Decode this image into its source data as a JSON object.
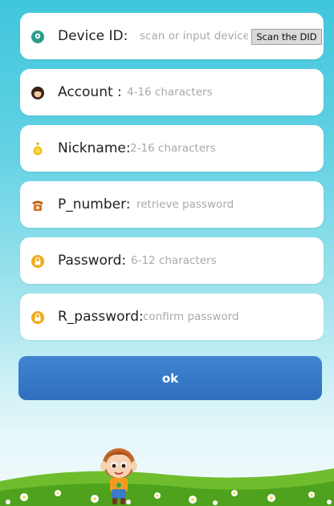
{
  "form": {
    "device_id": {
      "label": "Device ID:",
      "placeholder": "scan or input device ID",
      "value": "",
      "icon": "location-pin-icon"
    },
    "scan_button": {
      "label": "Scan the DID"
    },
    "account": {
      "label": "Account :",
      "placeholder": "4-16 characters",
      "value": "",
      "icon": "avatar-icon"
    },
    "nickname": {
      "label": "Nickname:",
      "placeholder": "2-16 characters",
      "value": "",
      "icon": "medal-icon"
    },
    "p_number": {
      "label": "P_number:",
      "placeholder": "retrieve password",
      "value": "",
      "icon": "telephone-icon"
    },
    "password": {
      "label": "Password:",
      "placeholder": "6-12 characters",
      "value": "",
      "icon": "lock-icon"
    },
    "r_password": {
      "label": "R_password:",
      "placeholder": "confirm password",
      "value": "",
      "icon": "lock-icon"
    }
  },
  "actions": {
    "ok_label": "ok"
  },
  "colors": {
    "accent": "#3174c4",
    "background_top": "#3fc6dc",
    "field_bg": "#ffffff",
    "placeholder": "#a9a9a9"
  }
}
